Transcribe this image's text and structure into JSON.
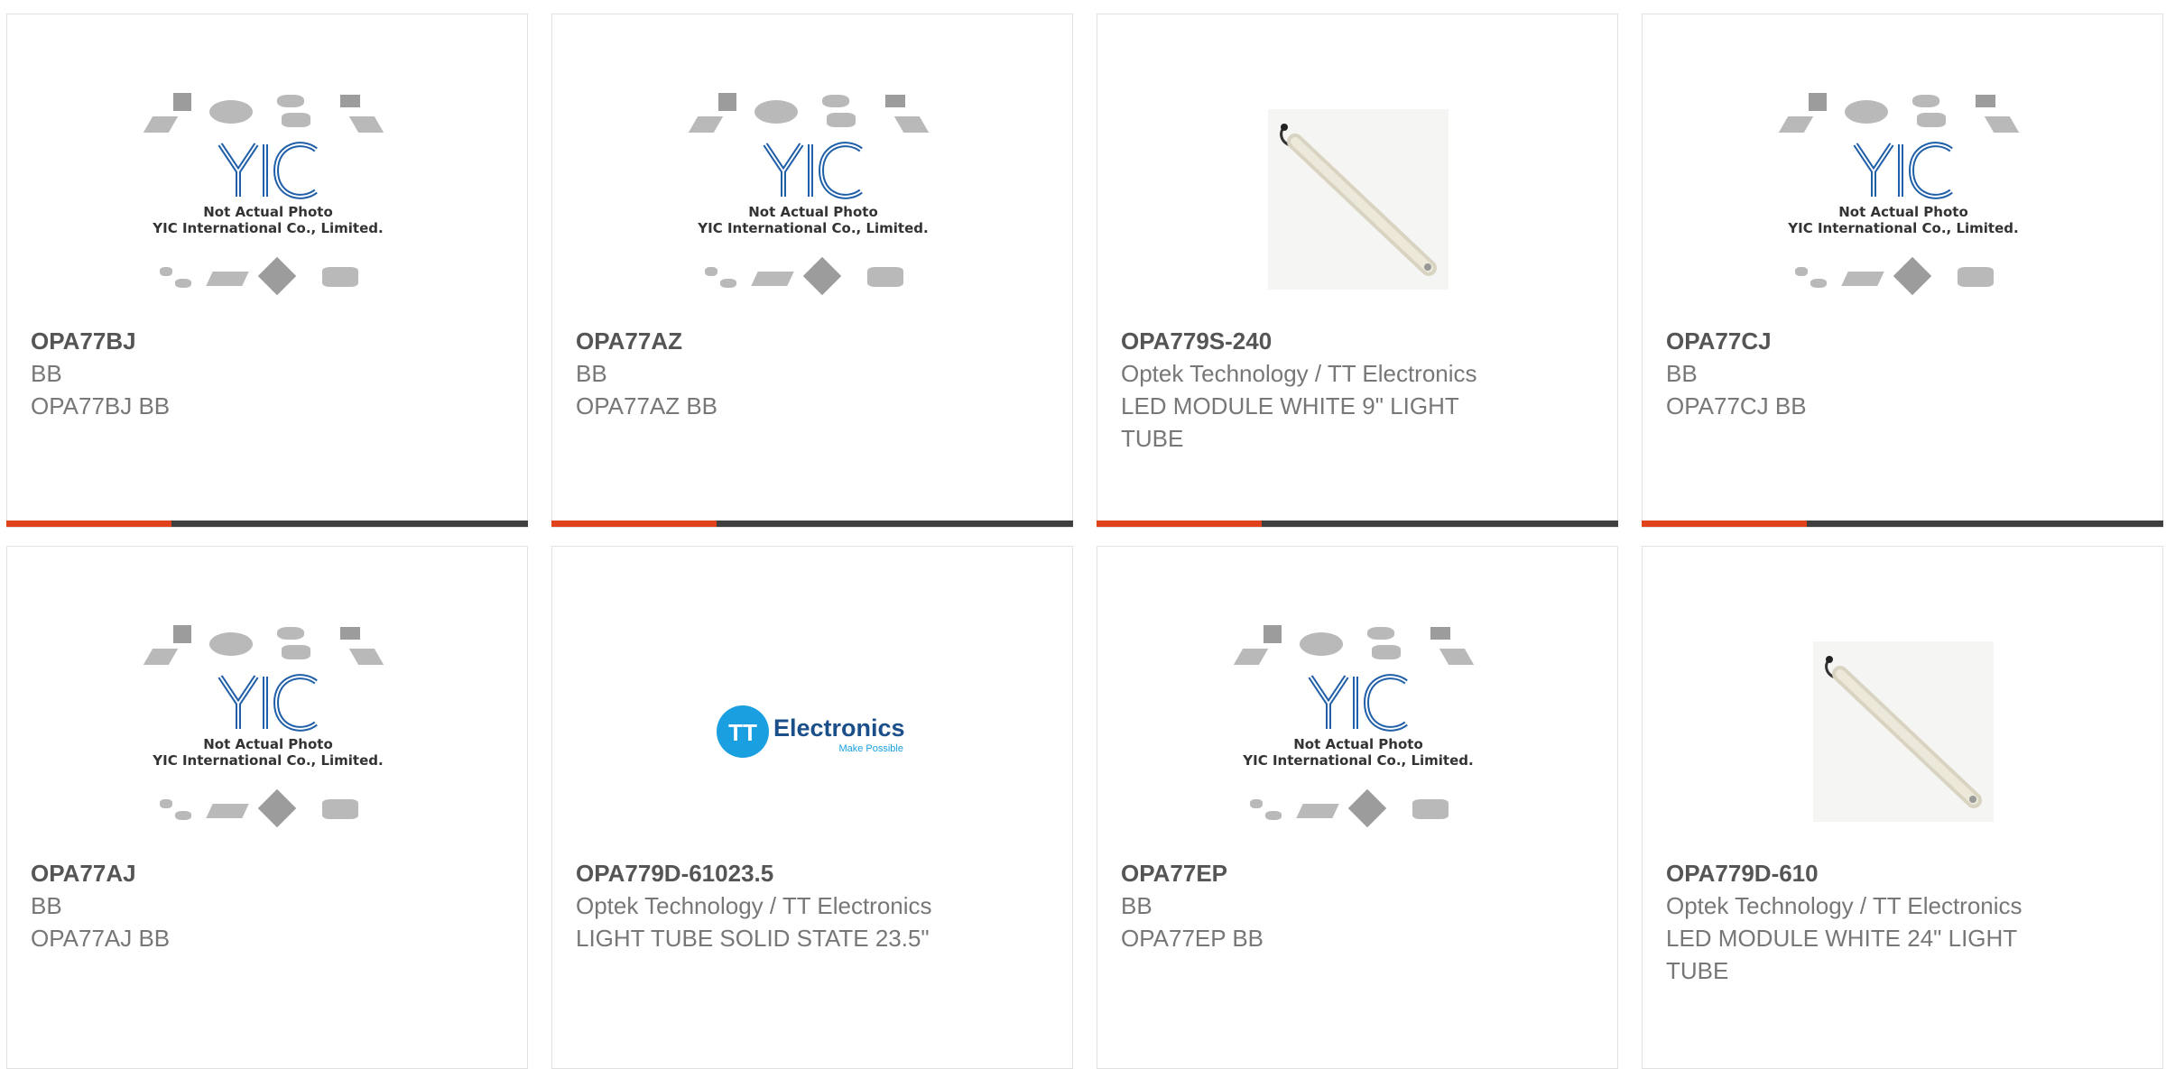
{
  "colors": {
    "accent_orange": "#e2421b",
    "accent_dark": "#3f3f3f",
    "tt_blue": "#1a9fe0"
  },
  "placeholder": {
    "line1": "Not Actual Photo",
    "line2": "YIC International Co., Limited.",
    "logo_text": "YIC"
  },
  "tt_logo": {
    "mark": "TT",
    "name": "Electronics",
    "tagline": "Make Possible"
  },
  "products": [
    {
      "part": "OPA77BJ",
      "maker": "BB",
      "desc": "OPA77BJ BB",
      "image": "yic-placeholder"
    },
    {
      "part": "OPA77AZ",
      "maker": "BB",
      "desc": "OPA77AZ BB",
      "image": "yic-placeholder"
    },
    {
      "part": "OPA779S-240",
      "maker": "Optek Technology / TT Electronics",
      "desc": "LED MODULE WHITE 9\" LIGHT TUBE",
      "image": "light-tube-photo"
    },
    {
      "part": "OPA77CJ",
      "maker": "BB",
      "desc": "OPA77CJ BB",
      "image": "yic-placeholder"
    },
    {
      "part": "OPA77AJ",
      "maker": "BB",
      "desc": "OPA77AJ BB",
      "image": "yic-placeholder"
    },
    {
      "part": "OPA779D-61023.5",
      "maker": "Optek Technology / TT Electronics",
      "desc": "LIGHT TUBE SOLID STATE 23.5\"",
      "image": "tt-electronics-logo"
    },
    {
      "part": "OPA77EP",
      "maker": "BB",
      "desc": "OPA77EP BB",
      "image": "yic-placeholder"
    },
    {
      "part": "OPA779D-610",
      "maker": "Optek Technology / TT Electronics",
      "desc": "LED MODULE WHITE 24\" LIGHT TUBE",
      "image": "light-tube-photo"
    }
  ]
}
